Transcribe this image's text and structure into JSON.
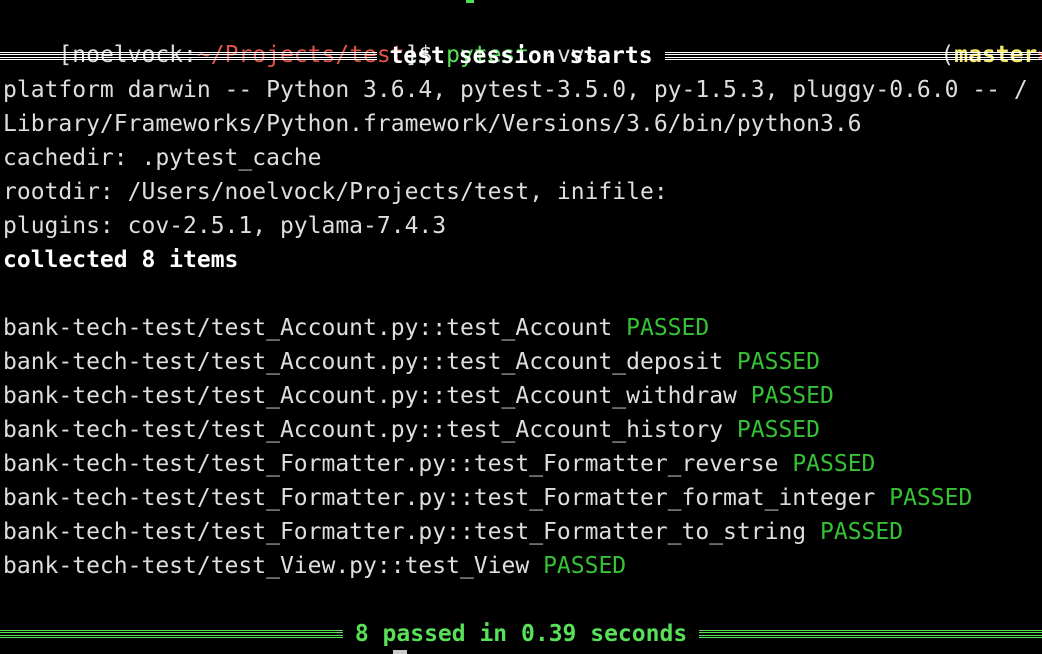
{
  "colors": {
    "background": "#000000",
    "text": "#dedede",
    "path_red": "#e0544c",
    "command_green": "#59e059",
    "passed_green": "#35c235",
    "branch_yellow": "#f2e86a",
    "dirty_red": "#f25a50",
    "header_white": "#ffffff"
  },
  "prompt": {
    "open_bracket": "[",
    "user": "noelvock",
    "colon": ":",
    "path": "~/Projects/test",
    "close_bracket": "]",
    "dollar": "$ ",
    "command": "pytest",
    "args": " -vvs",
    "branch_open": "(",
    "branch": "master",
    "dirty_marker": "✱",
    "branch_close": ")"
  },
  "header_rule": {
    "label": "test session starts"
  },
  "info_lines": [
    "platform darwin -- Python 3.6.4, pytest-3.5.0, py-1.5.3, pluggy-0.6.0 -- /",
    "Library/Frameworks/Python.framework/Versions/3.6/bin/python3.6",
    "cachedir: .pytest_cache",
    "rootdir: /Users/noelvock/Projects/test, inifile:",
    "plugins: cov-2.5.1, pylama-7.4.3"
  ],
  "collected": "collected 8 items",
  "tests": [
    {
      "name": "bank-tech-test/test_Account.py::test_Account",
      "status": "PASSED"
    },
    {
      "name": "bank-tech-test/test_Account.py::test_Account_deposit",
      "status": "PASSED"
    },
    {
      "name": "bank-tech-test/test_Account.py::test_Account_withdraw",
      "status": "PASSED"
    },
    {
      "name": "bank-tech-test/test_Account.py::test_Account_history",
      "status": "PASSED"
    },
    {
      "name": "bank-tech-test/test_Formatter.py::test_Formatter_reverse",
      "status": "PASSED"
    },
    {
      "name": "bank-tech-test/test_Formatter.py::test_Formatter_format_integer",
      "status": "PASSED"
    },
    {
      "name": "bank-tech-test/test_Formatter.py::test_Formatter_to_string",
      "status": "PASSED"
    },
    {
      "name": "bank-tech-test/test_View.py::test_View",
      "status": "PASSED"
    }
  ],
  "summary_rule": {
    "label": "8 passed in 0.39 seconds"
  }
}
